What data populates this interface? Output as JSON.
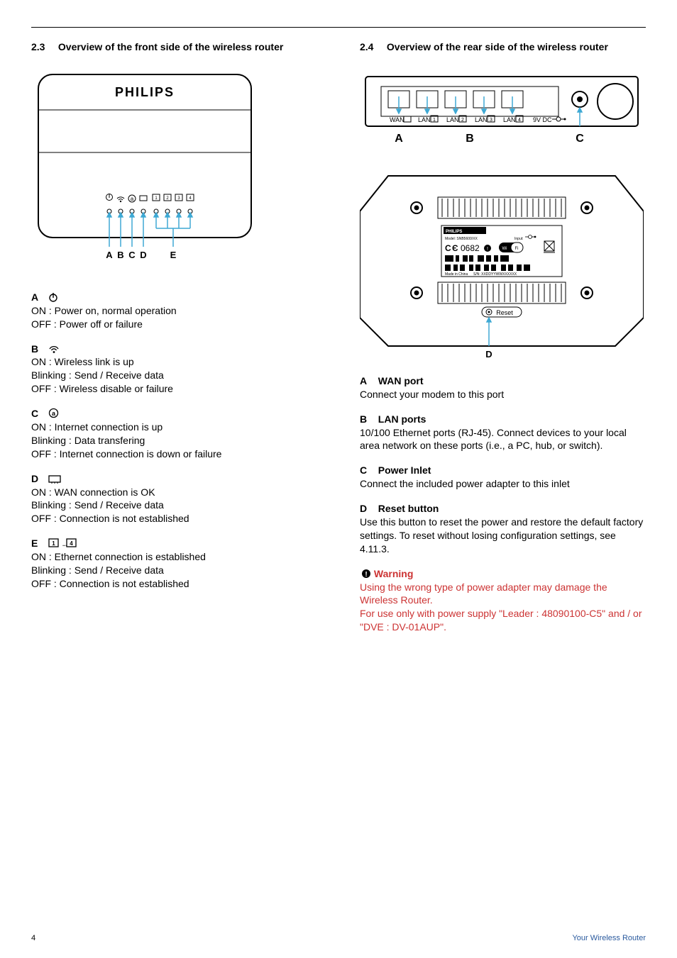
{
  "page_number": "4",
  "chapter_footer": "Your Wireless Router",
  "left": {
    "section_number": "2.3",
    "section_title": "Overview of the front side of the wireless router",
    "brand": "PHILIPS",
    "front_panel_letters": [
      "A",
      "B",
      "C",
      "D",
      "E"
    ],
    "items": {
      "A": {
        "letter": "A",
        "icon": "power-icon",
        "lines": [
          "ON : Power on, normal operation",
          "OFF : Power off or failure"
        ]
      },
      "B": {
        "letter": "B",
        "icon": "wifi-icon",
        "lines": [
          "ON : Wireless link is up",
          "Blinking : Send / Receive data",
          "OFF : Wireless disable or failure"
        ]
      },
      "C": {
        "letter": "C",
        "icon": "at-icon",
        "lines": [
          "ON : Internet connection is up",
          "Blinking : Data transfering",
          "OFF : Internet connection is down or failure"
        ]
      },
      "D": {
        "letter": "D",
        "icon": "wan-icon",
        "lines": [
          "ON : WAN connection is OK",
          "Blinking : Send / Receive data",
          "OFF : Connection is not established"
        ]
      },
      "E": {
        "letter": "E",
        "icon": "lan-1-4-icon",
        "lines": [
          "ON : Ethernet connection is established",
          "Blinking : Send / Receive data",
          "OFF : Connection is not established"
        ]
      }
    }
  },
  "right": {
    "section_number": "2.4",
    "section_title": "Overview of the rear side of the wireless router",
    "rear_labels": {
      "wan": "WAN",
      "lan": "LAN",
      "dc": "9V DC",
      "letters": [
        "A",
        "B",
        "C"
      ],
      "bottom_letter": "D",
      "reset": "Reset",
      "ce": "0682",
      "label_philips": "PHILIPS",
      "label_model": "Model: SNB5600/XX",
      "label_input": "Input:",
      "label_made": "Made in China",
      "label_sn": "S/N:",
      "label_snval": "XXDDYYWWXXXXXX"
    },
    "items": {
      "A": {
        "title": "WAN port",
        "text": "Connect your modem to this port"
      },
      "B": {
        "title": "LAN ports",
        "text": "10/100 Ethernet ports (RJ-45). Connect devices to your local area network on these ports (i.e., a PC, hub, or switch)."
      },
      "C": {
        "title": "Power Inlet",
        "text": "Connect the included power adapter to this inlet"
      },
      "D": {
        "title": "Reset button",
        "text": "Use this button to reset the power and restore the default factory settings. To reset without losing configuration settings, see 4.11.3."
      }
    },
    "warning": {
      "title": "Warning",
      "text1": "Using the wrong type of power adapter may damage the Wireless Router.",
      "text2": "For use only with power supply \"Leader : 48090100-C5\" and / or \"DVE : DV-01AUP\"."
    }
  }
}
